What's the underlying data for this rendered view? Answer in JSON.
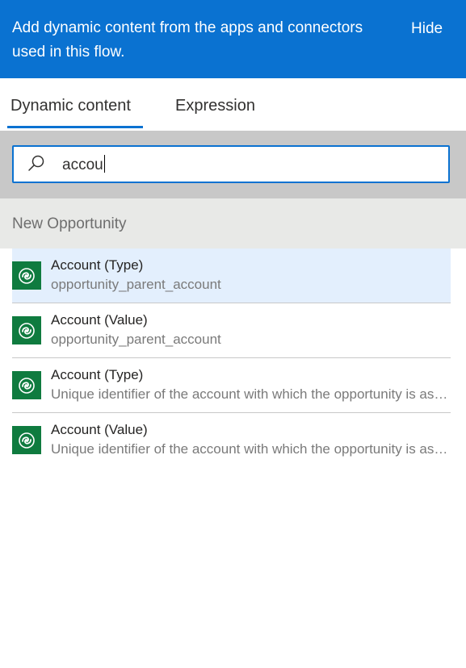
{
  "header": {
    "text": "Add dynamic content from the apps and connectors used in this flow.",
    "hide_label": "Hide"
  },
  "tabs": [
    {
      "label": "Dynamic content",
      "active": true
    },
    {
      "label": "Expression",
      "active": false
    }
  ],
  "search": {
    "value": "accou",
    "icon": "search-icon"
  },
  "section": {
    "title": "New Opportunity"
  },
  "items": [
    {
      "title": "Account (Type)",
      "subtitle": "opportunity_parent_account",
      "icon": "dataverse-icon",
      "selected": true
    },
    {
      "title": "Account (Value)",
      "subtitle": "opportunity_parent_account",
      "icon": "dataverse-icon",
      "selected": false
    },
    {
      "title": "Account (Type)",
      "subtitle": "Unique identifier of the account with which the opportunity is associated.",
      "icon": "dataverse-icon",
      "selected": false
    },
    {
      "title": "Account (Value)",
      "subtitle": "Unique identifier of the account with which the opportunity is associated.",
      "icon": "dataverse-icon",
      "selected": false
    }
  ],
  "colors": {
    "accent": "#0a72d1",
    "icon_bg": "#0f7b3f",
    "selected_row": "#e3effd"
  }
}
